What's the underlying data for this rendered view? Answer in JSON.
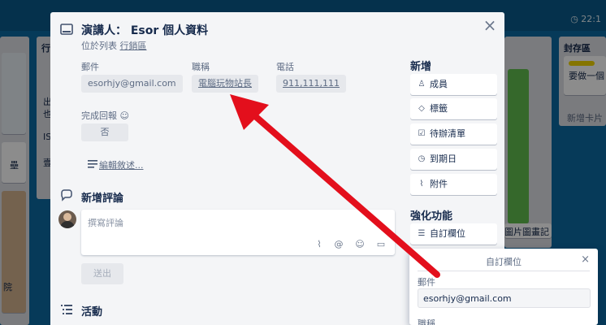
{
  "topbar": {
    "clock_text": "22:1"
  },
  "background": {
    "list_titles": [
      "行",
      "封存區"
    ],
    "card_texts": [
      "要做一個",
      "新增卡片",
      "圖片圖畫記"
    ],
    "side_fragments": [
      "出",
      "也",
      "IS",
      "壹",
      "壘",
      "院"
    ]
  },
  "card": {
    "title": "演講人： Esor 個人資料",
    "in_list_prefix": "位於列表",
    "in_list_name": "行銷區"
  },
  "fields": [
    {
      "label": "郵件",
      "value": "esorhjy@gmail.com"
    },
    {
      "label": "職稱",
      "value": "電腦玩物站長"
    },
    {
      "label": "電話",
      "value": "911,111,111"
    }
  ],
  "feedback": {
    "label": "完成回報",
    "value": "否"
  },
  "description": {
    "link_text": "編輯敘述..."
  },
  "comment": {
    "heading": "新增評論",
    "placeholder": "撰寫評論",
    "send_label": "送出"
  },
  "activity": {
    "heading": "活動"
  },
  "sidebar": {
    "add_heading": "新增",
    "add_buttons": [
      {
        "label": "成員",
        "icon": "person-icon"
      },
      {
        "label": "標籤",
        "icon": "tag-icon"
      },
      {
        "label": "待辦清單",
        "icon": "checklist-icon"
      },
      {
        "label": "到期日",
        "icon": "clock-icon"
      },
      {
        "label": "附件",
        "icon": "paperclip-icon"
      }
    ],
    "powerups_heading": "強化功能",
    "powerup_buttons": [
      {
        "label": "自訂欄位",
        "icon": "custom-fields-icon"
      }
    ]
  },
  "popover": {
    "title": "自訂欄位",
    "field1_label": "郵件",
    "field1_value": "esorhjy@gmail.com",
    "field2_label": "職稱"
  },
  "colors": {
    "annotation_arrow": "#e30f1c",
    "board_background": "#0b6aa2",
    "label_yellow": "#f2d600",
    "label_green": "#61bd4f"
  }
}
